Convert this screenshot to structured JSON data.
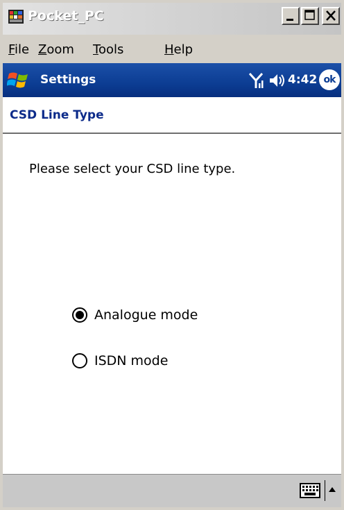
{
  "window": {
    "title": "Pocket_PC",
    "buttons": {
      "minimize": "_",
      "maximize": "□",
      "close": "×"
    }
  },
  "menu": {
    "items": [
      {
        "label": "File",
        "underline": "F"
      },
      {
        "label": "Zoom",
        "underline": "Z"
      },
      {
        "label": "Tools",
        "underline": "T"
      },
      {
        "label": "Help",
        "underline": "H"
      }
    ]
  },
  "navbar": {
    "title": "Settings",
    "time": "4:42",
    "ok_label": "ok",
    "icons": [
      "windows-start-icon",
      "signal-icon",
      "speaker-icon"
    ]
  },
  "page": {
    "header": "CSD Line Type",
    "prompt": "Please select your CSD line type.",
    "options": [
      {
        "label": "Analogue mode",
        "selected": true
      },
      {
        "label": "ISDN mode",
        "selected": false
      }
    ]
  },
  "commandbar": {
    "icons": [
      "keyboard-icon",
      "arrow-up-icon"
    ]
  },
  "colors": {
    "navbar": "#0c3d93",
    "header_text": "#0c2b8a",
    "chrome": "#d4d0c8"
  }
}
